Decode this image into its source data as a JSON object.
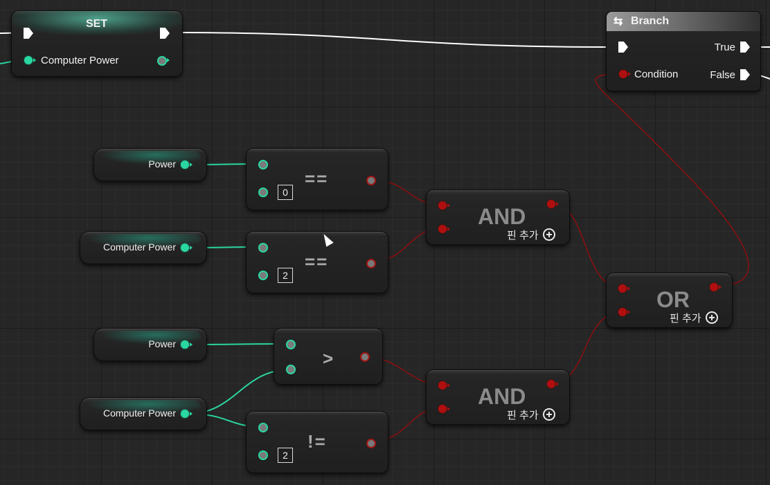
{
  "set_node": {
    "title": "SET",
    "pin_label": "Computer Power"
  },
  "branch_node": {
    "title": "Branch",
    "condition_label": "Condition",
    "true_label": "True",
    "false_label": "False"
  },
  "vars": [
    {
      "label": "Power"
    },
    {
      "label": "Computer Power"
    },
    {
      "label": "Power"
    },
    {
      "label": "Computer Power"
    }
  ],
  "ops": [
    {
      "symbol": "==",
      "value": "0"
    },
    {
      "symbol": "==",
      "value": "2"
    },
    {
      "symbol": ">"
    },
    {
      "symbol": "!=",
      "value": "2"
    }
  ],
  "gates": [
    {
      "title": "AND",
      "add_pin": "핀 추가"
    },
    {
      "title": "AND",
      "add_pin": "핀 추가"
    },
    {
      "title": "OR",
      "add_pin": "핀 추가"
    }
  ],
  "colors": {
    "exec": "#ffffff",
    "integer_pin": "#2ad7a2",
    "boolean_pin": "#a11414",
    "background": "#262626"
  },
  "icons": {
    "branch": "branch-icon",
    "add": "add-pin-icon",
    "cursor": "mouse-cursor-icon"
  }
}
